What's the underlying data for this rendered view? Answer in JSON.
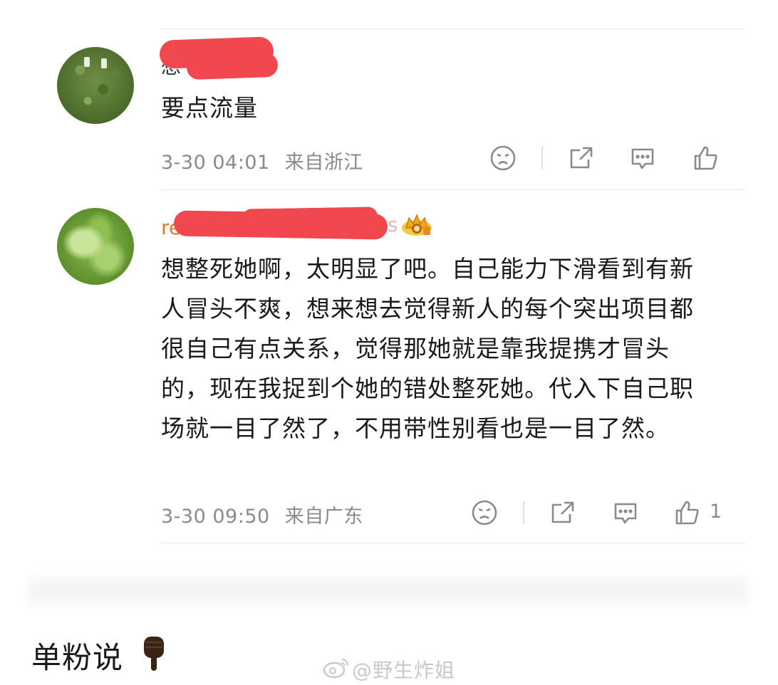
{
  "comments": [
    {
      "username_visible": "想",
      "text": "要点流量",
      "timestamp": "3-30 04:01",
      "location": "来自浙江",
      "like_count": "",
      "avatar": "grass-photo"
    },
    {
      "username_visible": "re",
      "username_tail": "s",
      "badge": "crown-badge",
      "text": "想整死她啊，太明显了吧。自己能力下滑看到有新人冒头不爽，想来想去觉得新人的每个突出项目都很自己有点关系，觉得那她就是靠我提携才冒头的，现在我捉到个她的错处整死她。代入下自己职场就一目了然了，不用带性别看也是一目了然。",
      "timestamp": "3-30 09:50",
      "location": "来自广东",
      "like_count": "1",
      "avatar": "lettuce-photo"
    }
  ],
  "caption": "单粉说",
  "caption_emoji": "pointing-down-hand",
  "watermark": "@野生炸姐",
  "colors": {
    "redaction": "#f0484e",
    "meta_text": "#8a8a8a",
    "username": "#e07a2e"
  }
}
